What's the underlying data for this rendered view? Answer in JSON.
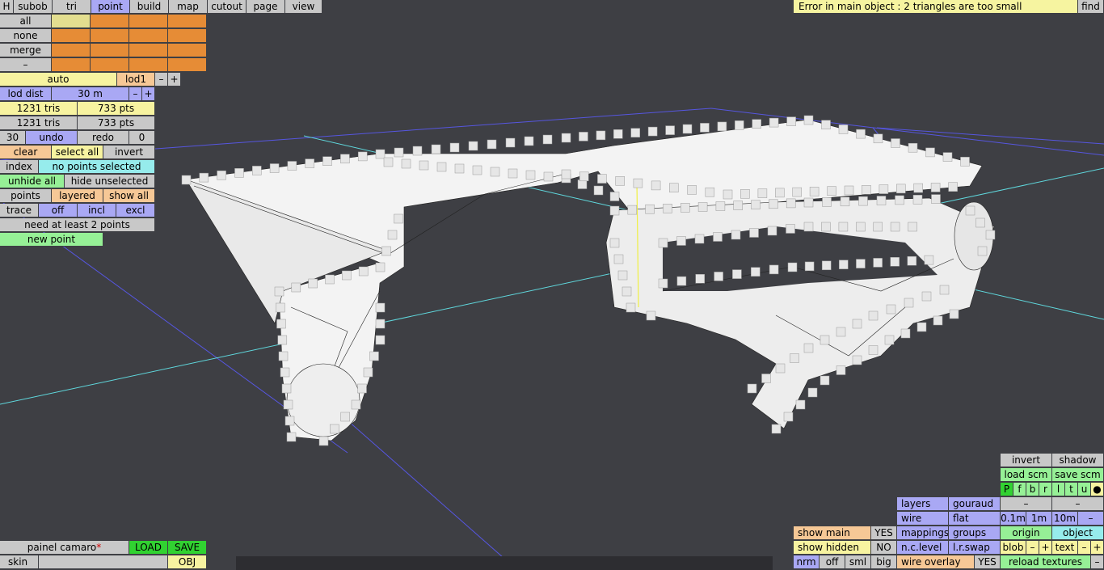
{
  "menu": {
    "h": "H",
    "subob": "subob",
    "tri": "tri",
    "point": "point",
    "build": "build",
    "map": "map",
    "cutout": "cutout",
    "page": "page",
    "view": "view"
  },
  "selection": {
    "all": "all",
    "none": "none",
    "merge": "merge",
    "minus": "–"
  },
  "lod": {
    "auto": "auto",
    "lod1": "lod1",
    "minus": "–",
    "plus": "+",
    "lod_dist_label": "lod dist",
    "lod_dist_value": "30 m"
  },
  "stats": {
    "tris_1": "1231 tris",
    "pts_1": "733 pts",
    "tris_2": "1231 tris",
    "pts_2": "733 pts"
  },
  "history": {
    "count": "30",
    "undo": "undo",
    "redo": "redo",
    "redo_count": "0"
  },
  "select_ops": {
    "clear": "clear",
    "select_all": "select all",
    "invert": "invert"
  },
  "index": {
    "label": "index",
    "status": "no points selected"
  },
  "visibility": {
    "unhide_all": "unhide all",
    "hide_unselected": "hide unselected"
  },
  "points_mode": {
    "points": "points",
    "layered": "layered",
    "show_all": "show all"
  },
  "trace": {
    "label": "trace",
    "off": "off",
    "incl": "incl",
    "excl": "excl"
  },
  "hint": "need at least 2 points",
  "new_point": "new point",
  "error_message": "Error in main object : 2 triangles are too small",
  "find": "find",
  "file": {
    "name": "painel camaro",
    "modified_marker": "*",
    "load": "LOAD",
    "save": "SAVE",
    "skin": "skin",
    "obj": "OBJ"
  },
  "display": {
    "show_main": "show main",
    "show_main_val": "YES",
    "show_hidden": "show hidden",
    "show_hidden_val": "NO",
    "nrm": "nrm",
    "off": "off",
    "sml": "sml",
    "big": "big",
    "wire_overlay": "wire overlay",
    "wire_overlay_val": "YES"
  },
  "render": {
    "layers": "layers",
    "gouraud": "gouraud",
    "wire": "wire",
    "flat": "flat",
    "mappings": "mappings",
    "groups": "groups",
    "nc_level": "n.c.level",
    "lr_swap": "l.r.swap"
  },
  "view": {
    "invert": "invert",
    "shadow": "shadow",
    "load_scm": "load scm",
    "save_scm": "save scm",
    "views": [
      "P",
      "f",
      "b",
      "r",
      "l",
      "t",
      "u"
    ],
    "dot": "●",
    "dash_a": "–",
    "dash_b": "–",
    "m01": "0.1m",
    "m1": "1m",
    "m10": "10m",
    "mminus": "–",
    "origin": "origin",
    "object": "object",
    "blob": "blob",
    "blob_minus": "–",
    "blob_plus": "+",
    "text": "text",
    "text_minus": "–",
    "text_plus": "+",
    "reload_textures": "reload textures",
    "reload_minus": "–"
  },
  "colors": {
    "background": "#3e3f44",
    "mesh_fill": "#f2f2f2",
    "vertex": "#e4e4e4",
    "grid_blue": "#5b5be6",
    "grid_cyan": "#5fd7dc",
    "selected_axis": "#f0f040"
  }
}
